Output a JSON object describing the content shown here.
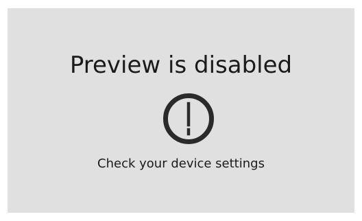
{
  "preview_state": {
    "title": "Preview is disabled",
    "message": "Check your device settings",
    "icon": "exclamation-circle-icon"
  },
  "colors": {
    "background": "#e0e0e0",
    "text": "#1a1a1a"
  }
}
